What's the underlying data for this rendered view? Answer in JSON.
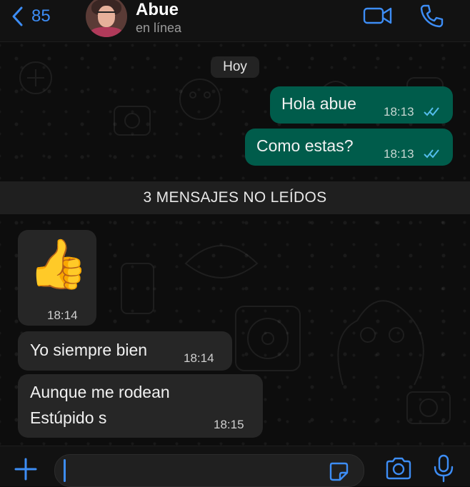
{
  "header": {
    "back_count": "85",
    "contact_name": "Abue",
    "contact_status": "en línea"
  },
  "chat": {
    "day_label": "Hoy",
    "unread_banner": "3 MENSAJES NO LEÍDOS",
    "messages": [
      {
        "direction": "out",
        "text": "Hola abue",
        "time": "18:13",
        "status": "read"
      },
      {
        "direction": "out",
        "text": "Como estas?",
        "time": "18:13",
        "status": "read"
      },
      {
        "direction": "in",
        "emoji": "👍",
        "time": "18:14"
      },
      {
        "direction": "in",
        "text": "Yo siempre bien",
        "time": "18:14"
      },
      {
        "direction": "in",
        "text_lines": [
          "Aunque me rodean",
          "Estúpido s"
        ],
        "time": "18:15"
      }
    ]
  },
  "icons": {
    "back": "chevron-left-icon",
    "video": "video-camera-icon",
    "call": "phone-icon",
    "add": "plus-icon",
    "sticker": "sticker-icon",
    "camera": "camera-icon",
    "mic": "microphone-icon"
  },
  "colors": {
    "accent": "#3d8df5",
    "outgoing_bubble": "#005c4b",
    "incoming_bubble": "#262626",
    "read_ticks": "#53bdeb"
  }
}
